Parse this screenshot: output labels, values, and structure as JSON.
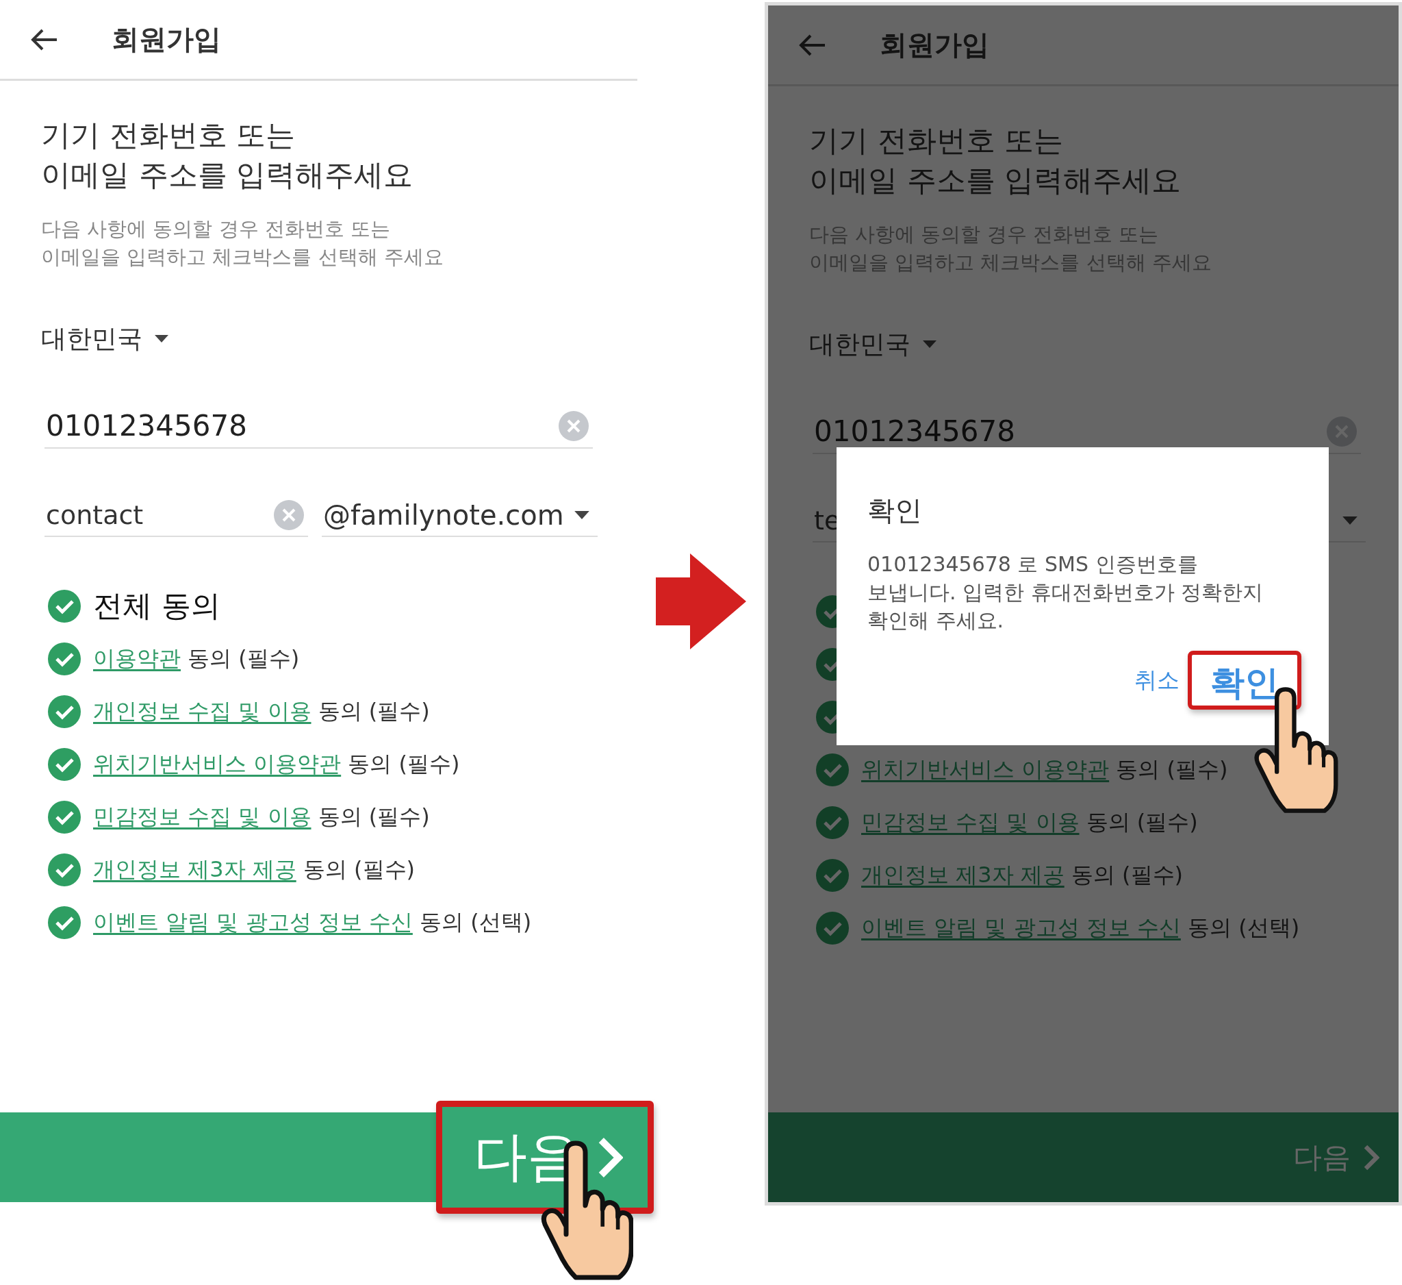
{
  "screens": [
    {
      "header": {
        "title": "회원가입"
      },
      "heading": "기기 전화번호 또는\n이메일 주소를 입력해주세요",
      "description": "다음 사항에 동의할 경우 전화번호 또는\n이메일을 입력하고 체크박스를 선택해 주세요",
      "country": "대한민국",
      "phone": {
        "value": "01012345678",
        "clearable": true
      },
      "email": {
        "local": "contact",
        "clearable": true,
        "domain": "@familynote.com",
        "domain_dropdown": true
      },
      "agreements": [
        {
          "kind": "all",
          "label": "전체 동의",
          "checked": true
        },
        {
          "kind": "term",
          "link": "이용약관",
          "suffix": "동의 (필수)",
          "checked": true
        },
        {
          "kind": "term",
          "link": "개인정보 수집 및 이용",
          "suffix": "동의 (필수)",
          "checked": true
        },
        {
          "kind": "term",
          "link": "위치기반서비스 이용약관",
          "suffix": "동의 (필수)",
          "checked": true
        },
        {
          "kind": "term",
          "link": "민감정보 수집 및 이용",
          "suffix": "동의 (필수)",
          "checked": true
        },
        {
          "kind": "term",
          "link": "개인정보 제3자 제공",
          "suffix": "동의 (필수)",
          "checked": true
        },
        {
          "kind": "term",
          "link": "이벤트 알림 및 광고성 정보 수신",
          "suffix": "동의 (선택)",
          "checked": true
        }
      ],
      "next_button": {
        "label": "다음",
        "highlighted": true
      },
      "dimmed": false
    },
    {
      "header": {
        "title": "회원가입"
      },
      "heading": "기기 전화번호 또는\n이메일 주소를 입력해주세요",
      "description": "다음 사항에 동의할 경우 전화번호 또는\n이메일을 입력하고 체크박스를 선택해 주세요",
      "country": "대한민국",
      "phone": {
        "value": "01012345678",
        "clearable": true
      },
      "email": {
        "local": "te",
        "domain_dropdown": true
      },
      "agreements": [
        {
          "kind": "all",
          "checked": true
        },
        {
          "kind": "term",
          "checked": true
        },
        {
          "kind": "term",
          "checked": true
        },
        {
          "kind": "term",
          "link": "위치기반서비스 이용약관",
          "suffix": "동의 (필수)",
          "checked": true
        },
        {
          "kind": "term",
          "link": "민감정보 수집 및 이용",
          "suffix": "동의 (필수)",
          "checked": true
        },
        {
          "kind": "term",
          "link": "개인정보 제3자 제공",
          "suffix": "동의 (필수)",
          "checked": true
        },
        {
          "kind": "term",
          "link": "이벤트 알림 및 광고성 정보 수신",
          "suffix": "동의 (선택)",
          "checked": true
        }
      ],
      "next_button": {
        "label": "다음",
        "highlighted": false
      },
      "dimmed": true,
      "dialog": {
        "title": "확인",
        "message": "01012345678   로 SMS 인증번호를\n보냅니다. 입력한 휴대전화번호가 정확한지\n확인해 주세요.",
        "buttons": [
          {
            "label": "취소",
            "highlighted": false
          },
          {
            "label": "확인",
            "highlighted": true
          }
        ]
      }
    }
  ]
}
